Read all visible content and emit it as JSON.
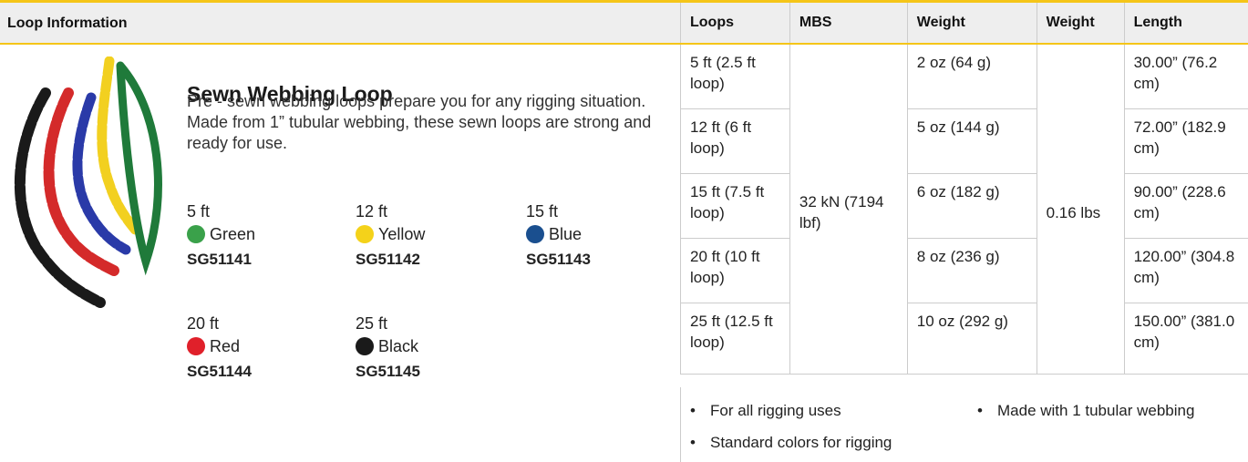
{
  "header": {
    "title": "Loop Information"
  },
  "product": {
    "title": "Sewn Webbing Loop",
    "description": "Pre - sewn webbing loops prepare you for any rigging situation. Made from 1” tubular webbing, these sewn loops are strong and ready for use."
  },
  "variants": [
    {
      "length": "5 ft",
      "color": "Green",
      "sku": "SG51141",
      "swatch": "#3aa14a"
    },
    {
      "length": "12 ft",
      "color": "Yellow",
      "sku": "SG51142",
      "swatch": "#f4d21a"
    },
    {
      "length": "15 ft",
      "color": "Blue",
      "sku": "SG51143",
      "swatch": "#1a4f8f"
    },
    {
      "length": "20 ft",
      "color": "Red",
      "sku": "SG51144",
      "swatch": "#e0202a"
    },
    {
      "length": "25 ft",
      "color": "Black",
      "sku": "SG51145",
      "swatch": "#1a1a1a"
    }
  ],
  "table": {
    "headers": [
      "Loops",
      "MBS",
      "Weight",
      "Weight",
      "Length"
    ],
    "mbs": "32 kN (7194 lbf)",
    "weight_lbs": "0.16 lbs",
    "rows": [
      {
        "loops": "5 ft (2.5 ft loop)",
        "weight": "2 oz (64 g)",
        "length": "30.00” (76.2 cm)"
      },
      {
        "loops": "12 ft (6 ft loop)",
        "weight": "5 oz (144 g)",
        "length": "72.00” (182.9 cm)"
      },
      {
        "loops": "15 ft (7.5 ft loop)",
        "weight": "6 oz (182 g)",
        "length": "90.00” (228.6 cm)"
      },
      {
        "loops": "20 ft (10 ft loop)",
        "weight": "8 oz (236 g)",
        "length": "120.00” (304.8 cm)"
      },
      {
        "loops": "25 ft (12.5 ft loop)",
        "weight": "10 oz (292 g)",
        "length": "150.00” (381.0 cm)"
      }
    ]
  },
  "features": [
    "For all rigging uses",
    "Made with 1 tubular webbing",
    "Standard colors for rigging"
  ],
  "colors": {
    "accent": "#f5c518",
    "header_bg": "#eeeeee"
  }
}
